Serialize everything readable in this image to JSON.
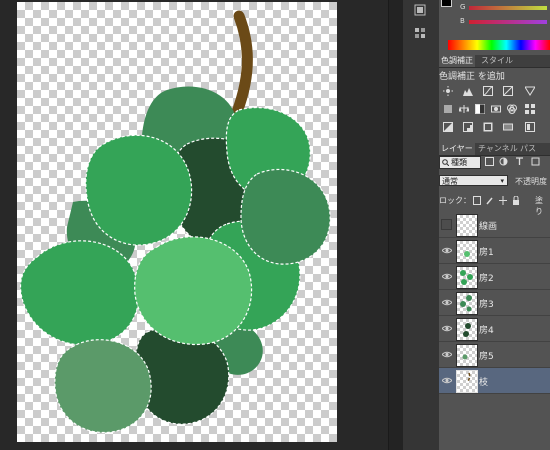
{
  "colors": {
    "stem": "#6b4a17",
    "grape_dark": "#234b2e",
    "grape_mid": "#3d8a56",
    "grape_green": "#34a457",
    "grape_light": "#55bf6f",
    "grape_muted": "#5b9a69",
    "panel_bg": "#535353",
    "selection": "#58677f"
  },
  "color_panel": {
    "g_label": "G",
    "b_label": "B"
  },
  "adjustments": {
    "tabs": [
      "色調補正",
      "スタイル"
    ],
    "title": "色調補正 を追加",
    "row1_icons": [
      "brightness-icon",
      "levels-icon",
      "curves-icon",
      "exposure-icon",
      "triangle-icon"
    ],
    "row2_icons": [
      "vibrance-icon",
      "balance-icon",
      "bw-icon",
      "photo-filter-icon",
      "mixer-icon",
      "grid-icon"
    ],
    "row3_icons": [
      "invert-icon",
      "posterize-icon",
      "threshold-icon",
      "gradient-map-icon",
      "selective-color-icon"
    ]
  },
  "layers_panel": {
    "tabs": [
      "レイヤー",
      "チャンネル",
      "パス"
    ],
    "filter_label": "種類",
    "blend_mode": "通常",
    "opacity_label": "不透明度",
    "lock_label": "ロック：",
    "fill_label": "塗り",
    "layers": [
      {
        "name": "線画",
        "visible": false,
        "selected": false
      },
      {
        "name": "房1",
        "visible": true,
        "selected": false
      },
      {
        "name": "房2",
        "visible": true,
        "selected": false
      },
      {
        "name": "房3",
        "visible": true,
        "selected": false
      },
      {
        "name": "房4",
        "visible": true,
        "selected": false
      },
      {
        "name": "房5",
        "visible": true,
        "selected": false
      },
      {
        "name": "枝",
        "visible": true,
        "selected": true
      }
    ]
  }
}
